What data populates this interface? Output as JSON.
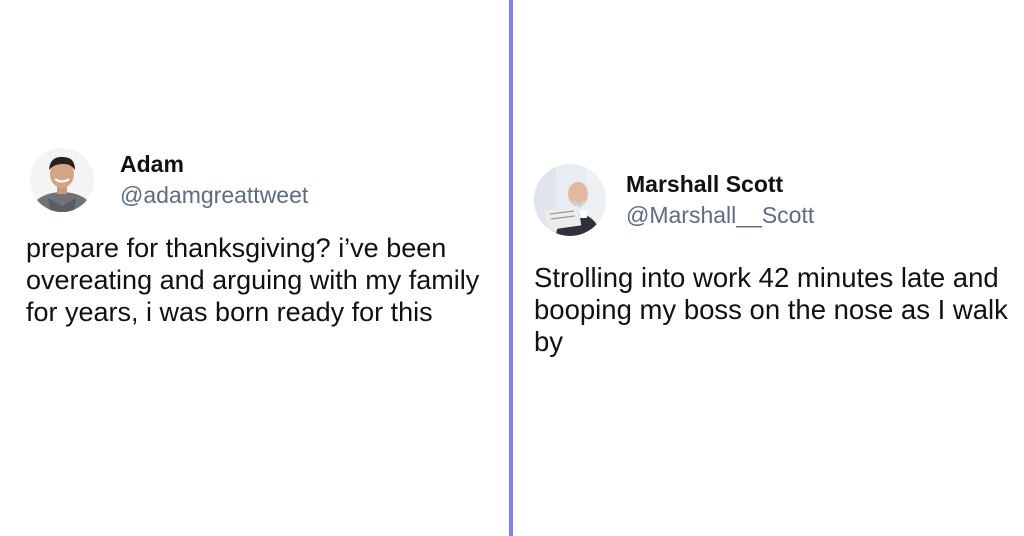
{
  "tweets": [
    {
      "display_name": "Adam",
      "handle": "@adamgreattweet",
      "text": "prepare for thanksgiving? i’ve been overeating and arguing with my family for years, i was born ready for this"
    },
    {
      "display_name": "Marshall Scott",
      "handle": "@Marshall__Scott",
      "text": "Strolling into work 42 minutes late and booping my boss on the nose as I walk by"
    }
  ],
  "colors": {
    "divider": "#8080ee",
    "handle": "#5b6d80",
    "text": "#111111"
  }
}
